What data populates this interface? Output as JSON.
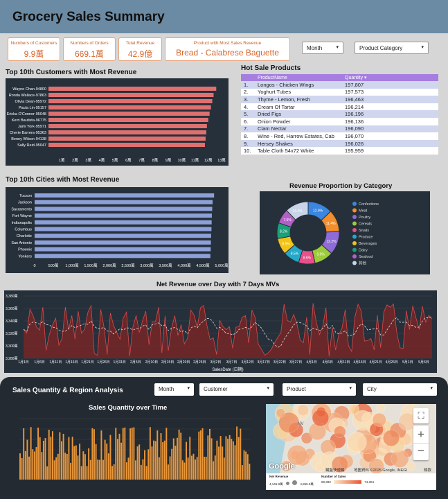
{
  "header": {
    "title": "Grocery Sales Summary"
  },
  "kpis": [
    {
      "label": "Numbers of Customers",
      "value": "9.9萬"
    },
    {
      "label": "Numbers of Orders",
      "value": "669.1萬"
    },
    {
      "label": "Total Revenue",
      "value": "42.9億"
    },
    {
      "label": "Product with Most Sales Revenue",
      "value": "Bread - Calabrese Baguette"
    }
  ],
  "filters": {
    "month": "Month",
    "category": "Product Category"
  },
  "top_customers": {
    "title": "Top 10th Customers with Most Revenue",
    "bar_color": "#e07070",
    "names": [
      "Wayne Chan-94800",
      "Ronda Wallace-97863",
      "Olivia Dean-95972",
      "Paula Lin-95157",
      "Ericka O'Connor-95048",
      "Kerri Bautista-96775",
      "Jami York-95971",
      "Cherie Barrera-95363",
      "Benny Wilson-94138",
      "Sally Reid-95047"
    ],
    "values": [
      12.6,
      12.4,
      12.3,
      12.2,
      12.1,
      12.0,
      11.9,
      11.85,
      11.8,
      11.75
    ],
    "ticks": [
      "1萬",
      "2萬",
      "3萬",
      "4萬",
      "5萬",
      "6萬",
      "7萬",
      "8萬",
      "9萬",
      "10萬",
      "11萬",
      "12萬",
      "13萬"
    ]
  },
  "hot_products": {
    "title": "Hot Sale Products",
    "headers": [
      "",
      "ProductName",
      "Quantity"
    ],
    "rows": [
      [
        "1.",
        "Longos - Chicken Wings",
        "197,807"
      ],
      [
        "2.",
        "Yoghurt Tubes",
        "197,573"
      ],
      [
        "3.",
        "Thyme - Lemon, Fresh",
        "196,463"
      ],
      [
        "4.",
        "Cream Of Tartar",
        "196,214"
      ],
      [
        "5.",
        "Dried Figs",
        "196,196"
      ],
      [
        "6.",
        "Onion Powder",
        "196,136"
      ],
      [
        "7.",
        "Clam Nectar",
        "196,090"
      ],
      [
        "8.",
        "Wine - Red, Harrow Estates, Cab",
        "196,070"
      ],
      [
        "9.",
        "Hersey Shakes",
        "196,026"
      ],
      [
        "10.",
        "Table Cloth 54x72 White",
        "195,959"
      ]
    ]
  },
  "top_cities": {
    "title": "Top 10th Cities with Most Revenue",
    "bar_color": "#8da0d8",
    "names": [
      "Tucson",
      "Jackson",
      "Sacramento",
      "Fort Wayne",
      "Indianapolis",
      "Columbus",
      "Charlotte",
      "San Antonio",
      "Phoenix",
      "Yonkers"
    ],
    "values": [
      4800,
      4760,
      4750,
      4740,
      4735,
      4730,
      4720,
      4715,
      4710,
      4700
    ],
    "ticks": [
      "0",
      "500萬",
      "1,000萬",
      "1,500萬",
      "2,000萬",
      "2,500萬",
      "3,000萬",
      "3,500萬",
      "4,000萬",
      "4,500萬",
      "5,000萬"
    ]
  },
  "category_donut": {
    "title": "Revenue Proportion by Category",
    "slices": [
      {
        "name": "Confections",
        "pct": 12.9,
        "color": "#3a86e0"
      },
      {
        "name": "Meat",
        "pct": 11.4,
        "color": "#f28e2b"
      },
      {
        "name": "Poultry",
        "pct": 12.2,
        "color": "#8f6bd8"
      },
      {
        "name": "Cereals",
        "pct": 9.9,
        "color": "#9ccc3a"
      },
      {
        "name": "Snails",
        "pct": 8.6,
        "color": "#e8508a"
      },
      {
        "name": "Produce",
        "pct": 8.5,
        "color": "#24a9c8"
      },
      {
        "name": "Beverages",
        "pct": 8.5,
        "color": "#f2c318"
      },
      {
        "name": "Dairy",
        "pct": 8.2,
        "color": "#1aa07a"
      },
      {
        "name": "Seafood",
        "pct": 7.6,
        "color": "#b45fc8"
      },
      {
        "name": "其他",
        "pct": 14.4,
        "color": "#c8d4e8"
      }
    ],
    "labels": [
      "12.9%",
      "11.4%",
      "12.2%",
      "9.9%",
      "8.6%",
      "8.5%",
      "8.5%",
      "8.2%",
      "7.6%",
      "14.4%"
    ]
  },
  "net_revenue": {
    "title": "Net Revenue over Day with 7 Days MVs",
    "xlabel": "SalesDate (日期)",
    "yticks": [
      "3,380萬",
      "3,360萬",
      "3,340萬",
      "3,320萬",
      "3,300萬",
      "3,280萬"
    ],
    "xticks": [
      "1月1日",
      "1月6日",
      "1月11日",
      "1月16日",
      "1月21日",
      "1月26日",
      "1月31日",
      "2月5日",
      "2月10日",
      "2月15日",
      "2月20日",
      "2月25日",
      "3月2日",
      "3月7日",
      "3月12日",
      "3月17日",
      "3月22日",
      "3月27日",
      "4月1日",
      "4月6日",
      "4月11日",
      "4月16日",
      "4月21日",
      "4月26日",
      "5月1日",
      "5月6日"
    ]
  },
  "bottom": {
    "title": "Sales Quantity & Region Analysis",
    "filters": [
      "Month",
      "Customer",
      "Product",
      "City"
    ],
    "sales_qty_title": "Sales Quantity over Time",
    "map_labels": {
      "brand": "Google",
      "shortcuts": "鍵盤快速鍵",
      "mapdata": "地圖資料 ©2025 Google, INEGI",
      "terms": "條款",
      "state": "NV"
    },
    "map_legend": {
      "size_title": "Net Revenue",
      "size_min": "4,146.8萬",
      "size_max": "4,855.0萬",
      "color_title": "Number of Sales",
      "color_min": "69,383",
      "color_max": "74,304"
    }
  }
}
